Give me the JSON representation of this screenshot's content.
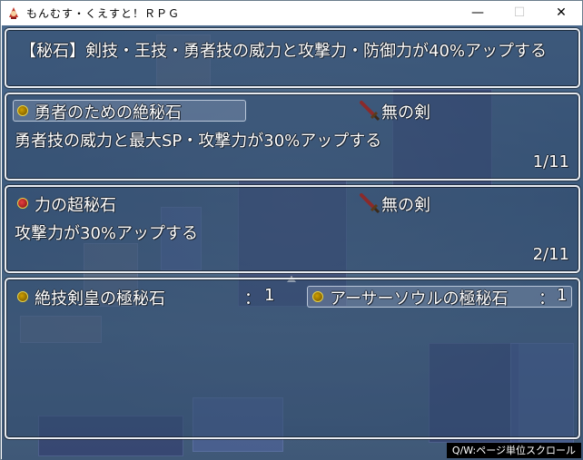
{
  "window": {
    "title": "もんむす・くえすと！ＲＰＧ",
    "controls": {
      "minimize": "—",
      "maximize": "☐",
      "close": "✕"
    }
  },
  "help_panel": {
    "text": "【秘石】剣技・王技・勇者技の威力と攻撃力・防御力が40%アップする"
  },
  "slot_1": {
    "gem_color": "yellow",
    "name": "勇者のための絶秘石",
    "weapon": "無の剣",
    "weapon_icon": "sword-icon",
    "description": "勇者技の威力と最大SP・攻撃力が30%アップする",
    "index": "1/11"
  },
  "slot_2": {
    "gem_color": "red",
    "name": "力の超秘石",
    "weapon": "無の剣",
    "weapon_icon": "sword-icon",
    "description": "攻撃力が30%アップする",
    "index": "2/11"
  },
  "inventory": {
    "items": [
      {
        "gem_color": "yellow",
        "name": "絶技剣皇の極秘石",
        "sep": "：",
        "count": "1"
      },
      {
        "gem_color": "yellow",
        "name": "アーサーソウルの極秘石",
        "sep": "：",
        "count": "1"
      }
    ]
  },
  "hint": {
    "text": "Q/W:ページ単位スクロール"
  }
}
